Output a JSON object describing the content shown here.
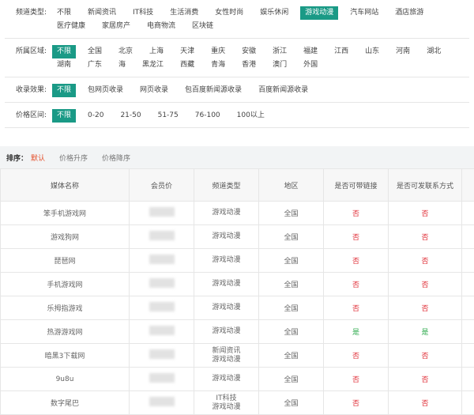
{
  "filters": [
    {
      "label": "频道类型:",
      "options": [
        "不限",
        "新闻资讯",
        "IT科技",
        "生活消费",
        "女性时尚",
        "娱乐休闲",
        "游戏动漫",
        "汽车网站",
        "酒店旅游",
        "医疗健康",
        "家居房产",
        "电商物流",
        "区块链"
      ],
      "active": 6
    },
    {
      "label": "所属区域:",
      "options": [
        "不限",
        "全国",
        "北京",
        "上海",
        "天津",
        "重庆",
        "安徽",
        "浙江",
        "福建",
        "江西",
        "山东",
        "河南",
        "湖北",
        "湖南",
        "广东",
        "海",
        "黑龙江",
        "西藏",
        "青海",
        "香港",
        "澳门",
        "外国"
      ],
      "active": 0
    },
    {
      "label": "收录效果:",
      "options": [
        "不限",
        "包网页收录",
        "网页收录",
        "包百度新闻源收录",
        "百度新闻源收录"
      ],
      "active": 0
    },
    {
      "label": "价格区间:",
      "options": [
        "不限",
        "0-20",
        "21-50",
        "51-75",
        "76-100",
        "100以上"
      ],
      "active": 0
    }
  ],
  "sort": {
    "label": "排序：",
    "options": [
      "默认",
      "价格升序",
      "价格降序"
    ],
    "active": 0
  },
  "table": {
    "headers": [
      "媒体名称",
      "会员价",
      "频道类型",
      "地区",
      "是否可带链接",
      "是否可发联系方式"
    ],
    "rows": [
      {
        "name": "笨手机游戏网",
        "type": "游戏动漫",
        "region": "全国",
        "link": "否",
        "contact": "否"
      },
      {
        "name": "游戏狗网",
        "type": "游戏动漫",
        "region": "全国",
        "link": "否",
        "contact": "否"
      },
      {
        "name": "琵琶网",
        "type": "游戏动漫",
        "region": "全国",
        "link": "否",
        "contact": "否"
      },
      {
        "name": "手机游戏网",
        "type": "游戏动漫",
        "region": "全国",
        "link": "否",
        "contact": "否"
      },
      {
        "name": "乐拇指游戏",
        "type": "游戏动漫",
        "region": "全国",
        "link": "否",
        "contact": "否"
      },
      {
        "name": "热游游戏网",
        "type": "游戏动漫",
        "region": "全国",
        "link": "是",
        "contact": "是"
      },
      {
        "name": "暗黑3下载网",
        "type": "新闻资讯 游戏动漫",
        "region": "全国",
        "link": "否",
        "contact": "否"
      },
      {
        "name": "9u8u",
        "type": "游戏动漫",
        "region": "全国",
        "link": "否",
        "contact": "否"
      },
      {
        "name": "数字尾巴",
        "type": "IT科技 游戏动漫",
        "region": "全国",
        "link": "否",
        "contact": "否"
      }
    ]
  }
}
